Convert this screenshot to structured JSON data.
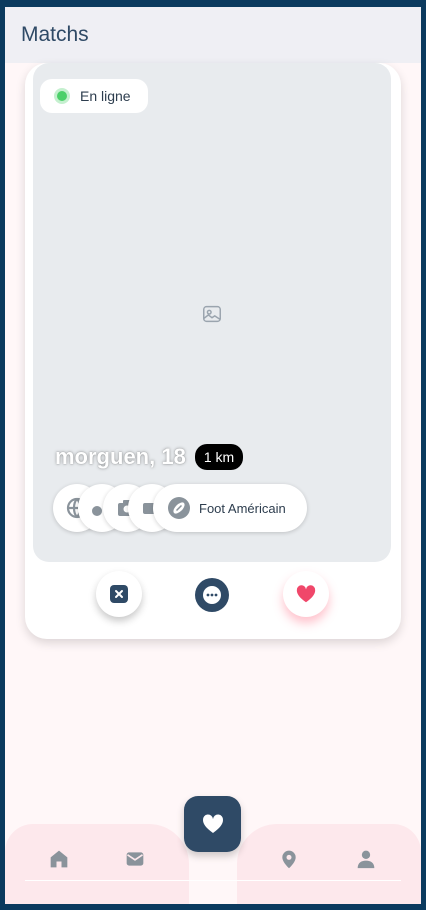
{
  "header": {
    "title": "Matchs"
  },
  "profile": {
    "status": "En ligne",
    "name_age": "morguen, 18",
    "distance": "1 km",
    "interests": [
      {
        "icon": "globe-icon"
      },
      {
        "icon": "person-icon"
      },
      {
        "icon": "camera-icon"
      },
      {
        "icon": "video-icon"
      },
      {
        "icon": "football-icon",
        "label": "Foot Américain"
      }
    ]
  },
  "actions": {
    "dismiss_icon": "close-icon",
    "chat_icon": "chat-bubble-icon",
    "like_icon": "heart-icon"
  },
  "bottom_nav": {
    "items": [
      "home-icon",
      "mail-icon",
      "heart-icon",
      "location-icon",
      "user-icon"
    ]
  },
  "colors": {
    "primary": "#2f4a66",
    "online": "#4cd06a",
    "like": "#f0476a",
    "nav_bg": "#fde8ec",
    "page_bg": "#fff7f8"
  }
}
